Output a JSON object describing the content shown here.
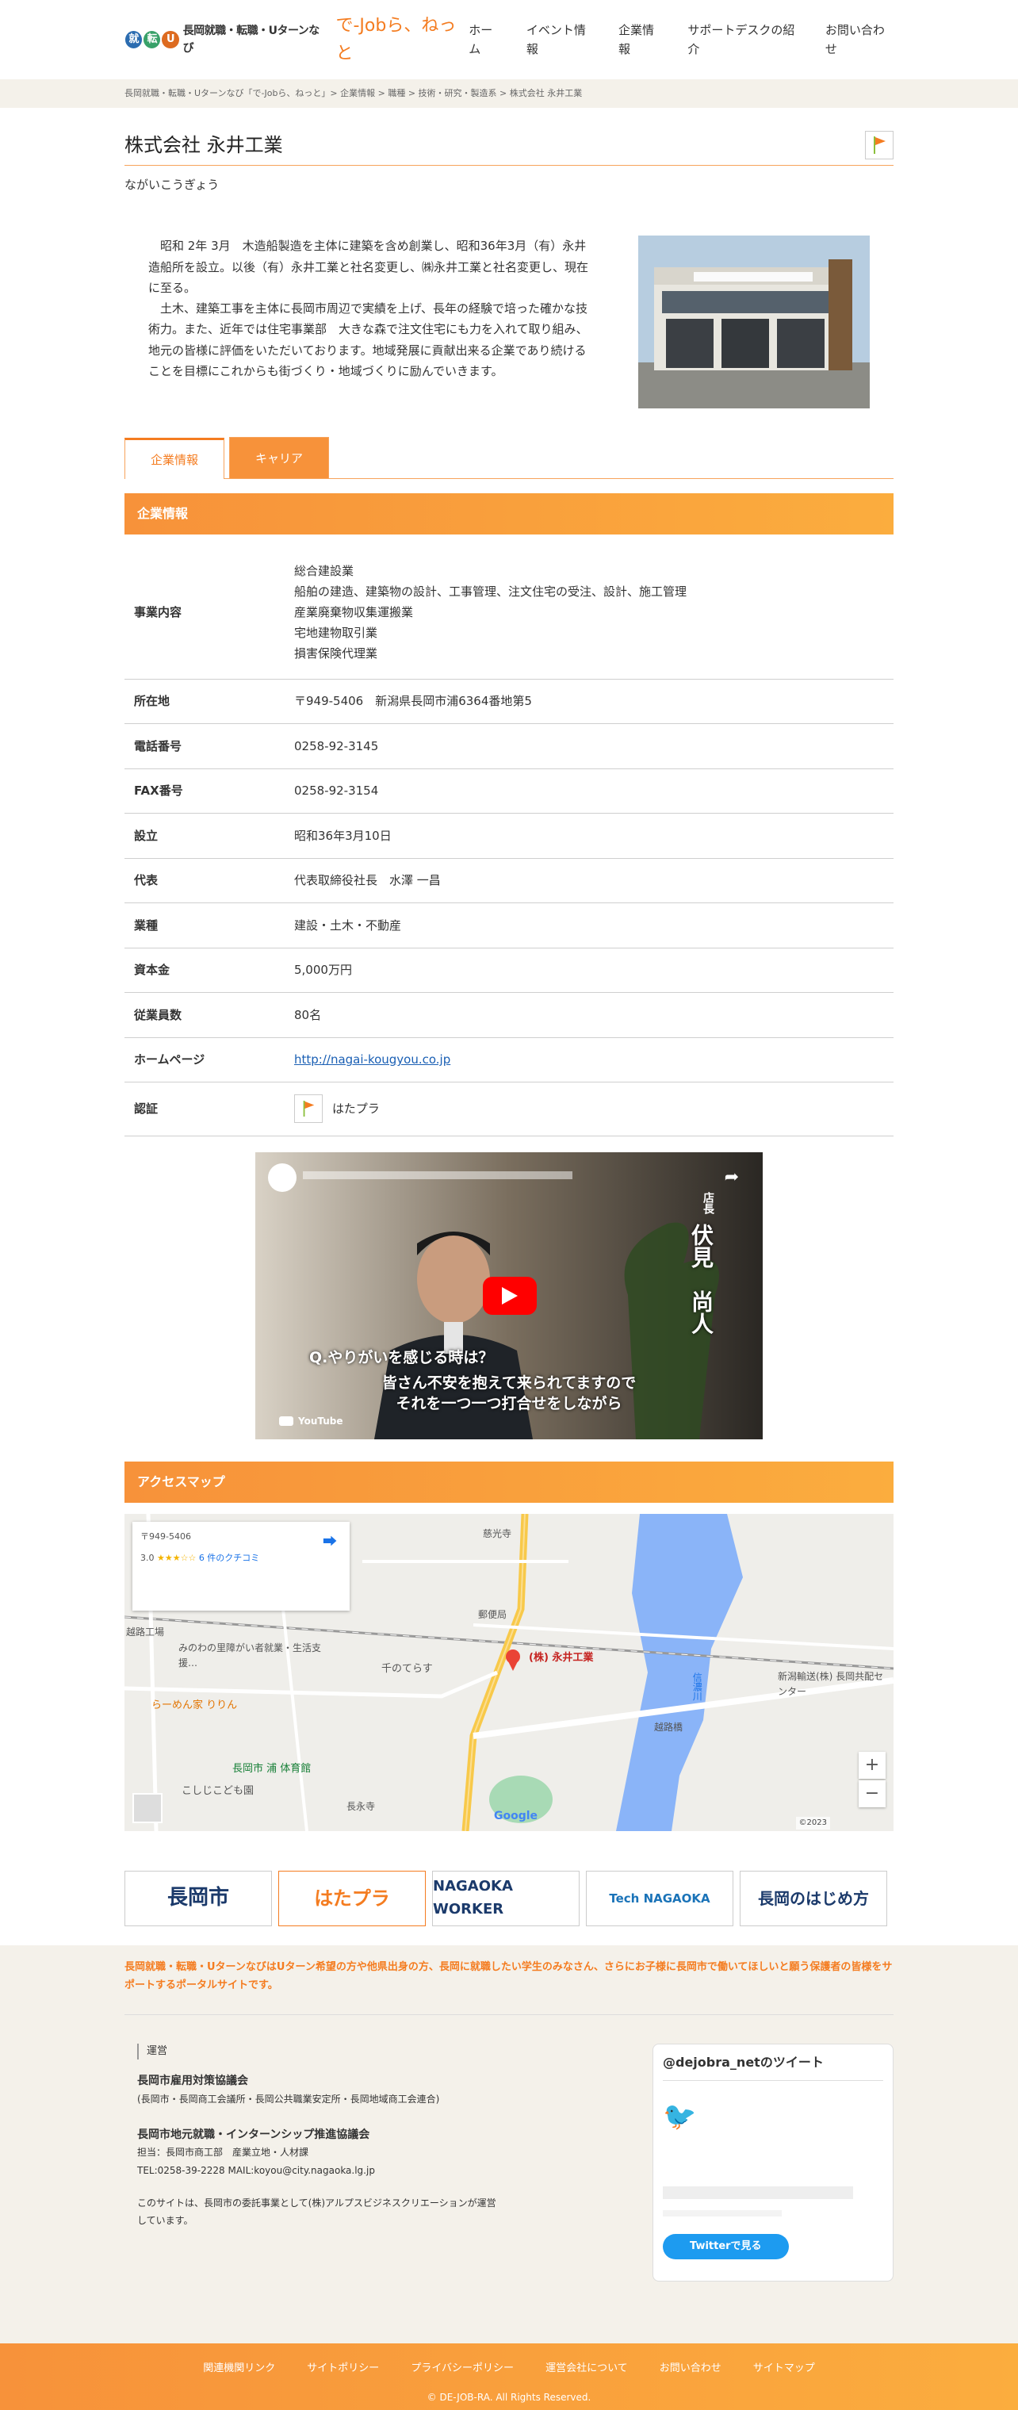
{
  "header": {
    "logo_text": "長岡就職・転職・Uターンなび",
    "logo_sub": "で-Jobら、ねっと",
    "nav": [
      "ホーム",
      "イベント情報",
      "企業情報",
      "サポートデスクの紹介",
      "お問い合わせ"
    ]
  },
  "breadcrumb": "長岡就職・転職・Uターンなび「で-Jobら、ねっと」> 企業情報 > 職種 > 技術・研究・製造系 > 株式会社 永井工業",
  "company": {
    "name": "株式会社 永井工業",
    "reading": "ながいこうぎょう",
    "intro_p1": "昭和 2年 3月　木造船製造を主体に建築を含め創業し、昭和36年3月（有）永井造船所を設立。以後（有）永井工業と社名変更し、㈱永井工業と社名変更し、現在に至る。",
    "intro_p2": "土木、建築工事を主体に長岡市周辺で実績を上げ、長年の経験で培った確かな技術力。また、近年では住宅事業部　大きな森で注文住宅にも力を入れて取り組み、地元の皆様に評価をいただいております。地域発展に貢献出来る企業であり続けることを目標にこれからも街づくり・地域づくりに励んでいきます。"
  },
  "tabs": [
    "企業情報",
    "キャリア"
  ],
  "section_info": "企業情報",
  "info": {
    "business_label": "事業内容",
    "business": [
      "総合建設業",
      "船舶の建造、建築物の設計、工事管理、注文住宅の受注、設計、施工管理",
      "産業廃棄物収集運搬業",
      "宅地建物取引業",
      "損害保険代理業"
    ],
    "rows": [
      {
        "label": "所在地",
        "value": "〒949-5406　新潟県長岡市浦6364番地第5"
      },
      {
        "label": "電話番号",
        "value": "0258-92-3145"
      },
      {
        "label": "FAX番号",
        "value": "0258-92-3154"
      },
      {
        "label": "設立",
        "value": "昭和36年3月10日"
      },
      {
        "label": "代表",
        "value": "代表取締役社長　水澤 一昌"
      },
      {
        "label": "業種",
        "value": "建設・土木・不動産"
      },
      {
        "label": "資本金",
        "value": "5,000万円"
      },
      {
        "label": "従業員数",
        "value": "80名"
      }
    ],
    "homepage_label": "ホームページ",
    "homepage": "http://nagai-kougyou.co.jp",
    "cert_label": "認証",
    "cert": "はたプラ"
  },
  "video": {
    "question": "Q.やりがいを感じる時は？",
    "caption1": "皆さん不安を抱えて来られてますので",
    "caption2": "それを一つ一つ打合せをしながら",
    "name_title": "店長",
    "name": "伏見　尚人",
    "youtube": "YouTube"
  },
  "section_access": "アクセスマップ",
  "map": {
    "card_address": "〒949-5406",
    "card_rating": "3.0",
    "card_reviews": "6 件のクチコミ",
    "marker_label": "(株) 永井工業",
    "label_1": "らーめん家 りりん",
    "label_2": "長岡市 浦 体育館",
    "label_3": "こしじこども園",
    "label_4": "千のてらす",
    "label_5": "越路工場",
    "label_6": "新潟輸送(株) 長岡共配センター",
    "label_7": "越路橋",
    "label_8": "郵便局",
    "label_9": "慈光寺",
    "label_10": "長永寺",
    "label_11": "信濃川",
    "label_12": "みのわの里障がい者就業・生活支援…",
    "copyright": "©2023",
    "google": "Google"
  },
  "banners": [
    "長岡市",
    "はたプラ",
    "NAGAOKA WORKER",
    "Tech NAGAOKA",
    "長岡のはじめ方"
  ],
  "footer": {
    "lead": "長岡就職・転職・UターンなびはUターン希望の方や他県出身の方、長岡に就職したい学生のみなさん、さらにお子様に長岡市で働いてほしいと願う保護者の皆様をサポートするポータルサイトです。",
    "unei_label": "運営",
    "org1": "長岡市雇用対策協議会",
    "org1_sub": "(長岡市・長岡商工会議所・長岡公共職業安定所・長岡地域商工会連合)",
    "org2": "長岡市地元就職・インターンシップ推進協議会",
    "org2_sub1": "担当：長岡市商工部　産業立地・人材課",
    "org2_sub2": "TEL:0258-39-2228 MAIL:koyou@city.nagaoka.lg.jp",
    "note": "このサイトは、長岡市の委託事業として(株)アルプスビジネスクリエーションが運営しています。",
    "twitter_title": "@dejobra_netのツイート",
    "twitter_btn": "Twitterで見る",
    "links": [
      "関連機関リンク",
      "サイトポリシー",
      "プライバシーポリシー",
      "運営会社について",
      "お問い合わせ",
      "サイトマップ"
    ],
    "copyright": "© DE-JOB-RA. All Rights Reserved."
  }
}
